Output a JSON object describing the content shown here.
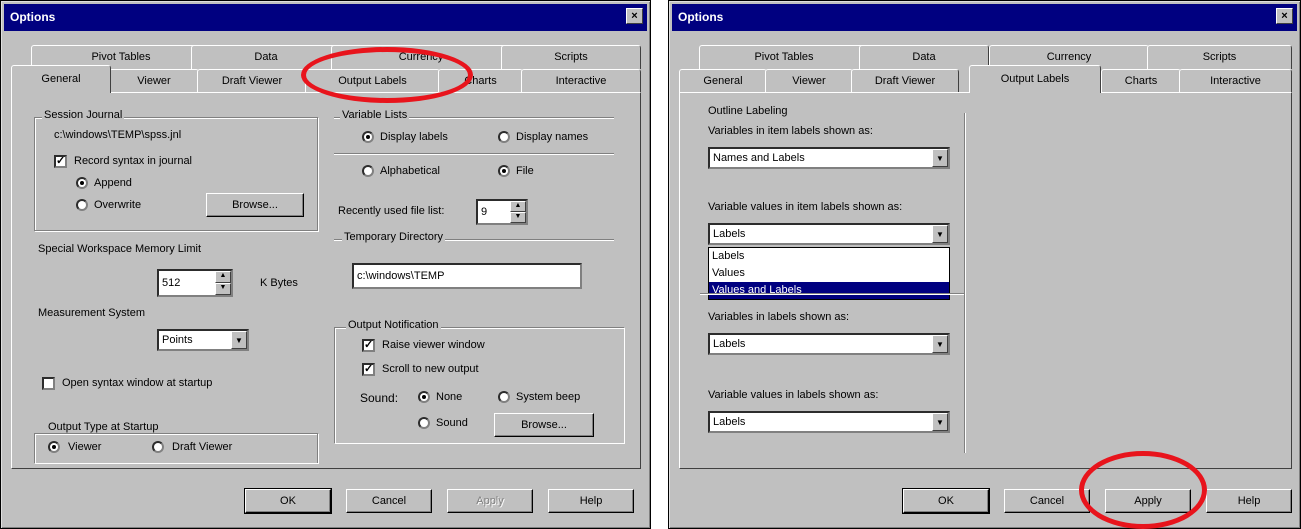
{
  "left": {
    "title": "Options",
    "close": "×",
    "tabs_back": [
      "Pivot Tables",
      "Data",
      "Currency",
      "Scripts"
    ],
    "tabs_front": [
      "General",
      "Viewer",
      "Draft Viewer",
      "Output Labels",
      "Charts",
      "Interactive"
    ],
    "session_journal": {
      "label": "Session Journal",
      "path": "c:\\windows\\TEMP\\spss.jnl",
      "record": "Record syntax in journal",
      "append": "Append",
      "overwrite": "Overwrite",
      "browse": "Browse..."
    },
    "memory": {
      "label": "Special Workspace Memory Limit",
      "value": "512",
      "unit": "K Bytes"
    },
    "measurement": {
      "label": "Measurement System",
      "value": "Points"
    },
    "open_syntax": "Open syntax window at startup",
    "output_type": {
      "label": "Output Type at Startup",
      "viewer": "Viewer",
      "draft": "Draft Viewer"
    },
    "variable_lists": {
      "label": "Variable Lists",
      "display_labels": "Display labels",
      "display_names": "Display names",
      "alphabetical": "Alphabetical",
      "file": "File"
    },
    "recent_files": {
      "label": "Recently used file list:",
      "value": "9"
    },
    "temp_dir": {
      "label": "Temporary Directory",
      "value": "c:\\windows\\TEMP"
    },
    "output_notification": {
      "label": "Output Notification",
      "raise": "Raise viewer window",
      "scroll": "Scroll to new output",
      "sound": "Sound:",
      "none": "None",
      "system_beep": "System beep",
      "sound_opt": "Sound",
      "browse": "Browse..."
    },
    "buttons": {
      "ok": "OK",
      "cancel": "Cancel",
      "apply": "Apply",
      "help": "Help"
    }
  },
  "right": {
    "title": "Options",
    "close": "×",
    "tabs_back": [
      "Pivot Tables",
      "Data",
      "Currency",
      "Scripts"
    ],
    "tabs_front": [
      "General",
      "Viewer",
      "Draft Viewer",
      "Output Labels",
      "Charts",
      "Interactive"
    ],
    "outline": {
      "label": "Outline Labeling",
      "var_item_label": "Variables in item labels shown as:",
      "var_item_value": "Names and Labels",
      "val_item_label": "Variable values in item labels shown as:",
      "val_item_value": "Labels",
      "options": [
        "Labels",
        "Values",
        "Values and Labels"
      ]
    },
    "pivot": {
      "var_labels_label": "Variables in labels shown as:",
      "var_labels_value": "Labels",
      "val_labels_label": "Variable values in labels shown as:",
      "val_labels_value": "Labels"
    },
    "buttons": {
      "ok": "OK",
      "cancel": "Cancel",
      "apply": "Apply",
      "help": "Help"
    }
  },
  "colors": {
    "face": "#c0c0c0",
    "title": "#000080",
    "highlight_ring": "#e8141c"
  }
}
